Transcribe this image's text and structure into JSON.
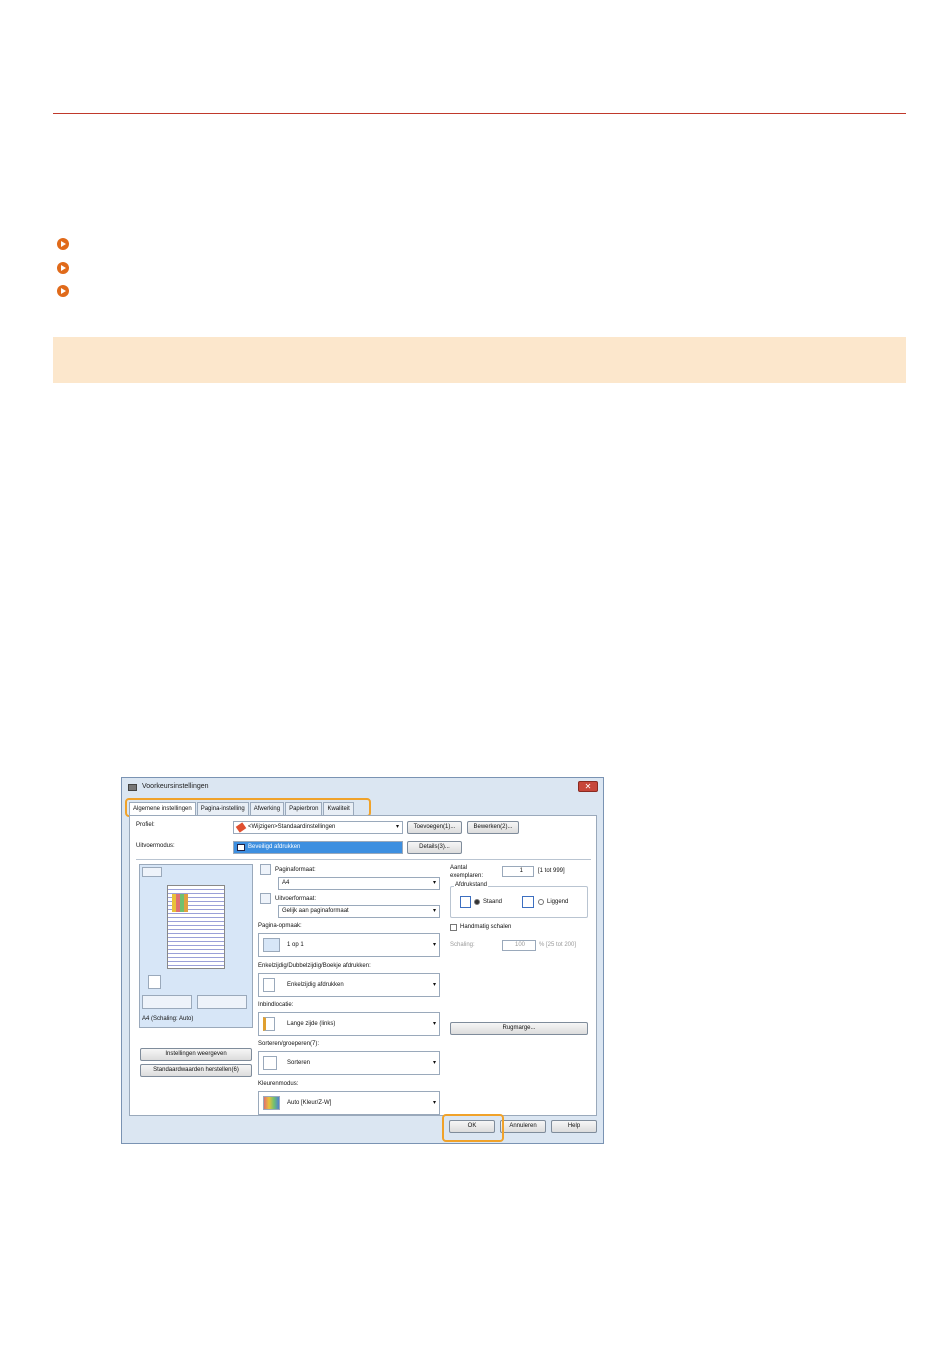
{
  "dialog": {
    "title": "Voorkeursinstellingen",
    "close": "✕",
    "tabs": [
      "Algemene instellingen",
      "Pagina-instelling",
      "Afwerking",
      "Papierbron",
      "Kwaliteit"
    ],
    "profile_label": "Profiel:",
    "profile_value": "<Wijzigen>Standaardinstellingen",
    "add_button": "Toevoegen(1)...",
    "edit_button": "Bewerken(2)...",
    "output_label": "Uitvoermodus:",
    "output_value": "Beveiligd afdrukken",
    "details_button": "Details(3)...",
    "preview_caption": "A4 (Schaling: Auto)",
    "show_settings_button": "Instellingen weergeven",
    "restore_defaults_button": "Standaardwaarden herstellen(6)",
    "page_size_label": "Paginaformaat:",
    "page_size_value": "A4",
    "output_size_label": "Uitvoerformaat:",
    "output_size_value": "Gelijk aan paginaformaat",
    "layout_label": "Pagina-opmaak:",
    "layout_value": "1 op 1",
    "duplex_label": "Enkelzijdig/Dubbelzijdig/Boekje afdrukken:",
    "duplex_value": "Enkelzijdig afdrukken",
    "binding_label": "Inbindlocatie:",
    "binding_value": "Lange zijde (links)",
    "collate_label": "Sorteren/groeperen(7):",
    "collate_value": "Sorteren",
    "color_label": "Kleurenmodus:",
    "color_value": "Auto [Kleur/Z-W]",
    "copies_label": "Aantal exemplaren:",
    "copies_value": "1",
    "copies_range": "[1 tot 999]",
    "orientation_label": "Afdrukstand",
    "portrait": "Staand",
    "landscape": "Liggend",
    "manual_scale_label": "Handmatig schalen",
    "scaling_label": "Schaling:",
    "scaling_value": "100",
    "scaling_range": "% [25 tot 200]",
    "margin_button": "Rugmarge...",
    "ok_button": "OK",
    "cancel_button": "Annuleren",
    "help_button": "Help"
  }
}
